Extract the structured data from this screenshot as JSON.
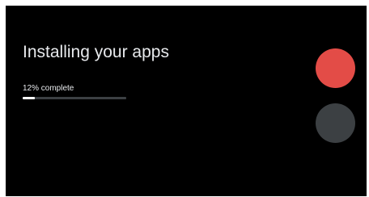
{
  "install": {
    "title": "Installing your apps",
    "progress_text": "12% complete",
    "progress_percent": 12
  },
  "colors": {
    "background": "#000000",
    "text": "#e8eaed",
    "progress_track": "#3c4043",
    "progress_fill": "#ffffff",
    "accent_dot": "#e34c47",
    "secondary_dot": "#3c4043"
  }
}
